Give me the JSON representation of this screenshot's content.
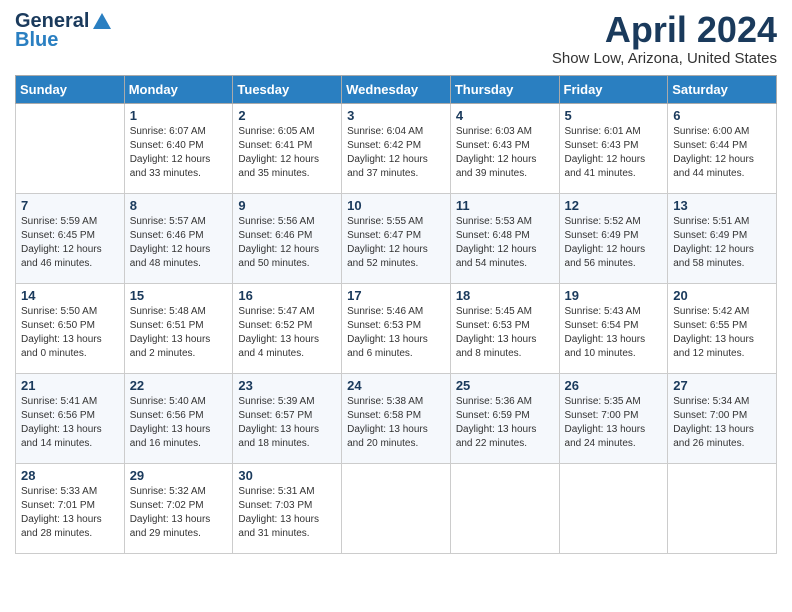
{
  "logo": {
    "general": "General",
    "blue": "Blue",
    "icon": "▶"
  },
  "title": "April 2024",
  "subtitle": "Show Low, Arizona, United States",
  "days_of_week": [
    "Sunday",
    "Monday",
    "Tuesday",
    "Wednesday",
    "Thursday",
    "Friday",
    "Saturday"
  ],
  "weeks": [
    [
      {
        "day": "",
        "content": ""
      },
      {
        "day": "1",
        "content": "Sunrise: 6:07 AM\nSunset: 6:40 PM\nDaylight: 12 hours\nand 33 minutes."
      },
      {
        "day": "2",
        "content": "Sunrise: 6:05 AM\nSunset: 6:41 PM\nDaylight: 12 hours\nand 35 minutes."
      },
      {
        "day": "3",
        "content": "Sunrise: 6:04 AM\nSunset: 6:42 PM\nDaylight: 12 hours\nand 37 minutes."
      },
      {
        "day": "4",
        "content": "Sunrise: 6:03 AM\nSunset: 6:43 PM\nDaylight: 12 hours\nand 39 minutes."
      },
      {
        "day": "5",
        "content": "Sunrise: 6:01 AM\nSunset: 6:43 PM\nDaylight: 12 hours\nand 41 minutes."
      },
      {
        "day": "6",
        "content": "Sunrise: 6:00 AM\nSunset: 6:44 PM\nDaylight: 12 hours\nand 44 minutes."
      }
    ],
    [
      {
        "day": "7",
        "content": "Sunrise: 5:59 AM\nSunset: 6:45 PM\nDaylight: 12 hours\nand 46 minutes."
      },
      {
        "day": "8",
        "content": "Sunrise: 5:57 AM\nSunset: 6:46 PM\nDaylight: 12 hours\nand 48 minutes."
      },
      {
        "day": "9",
        "content": "Sunrise: 5:56 AM\nSunset: 6:46 PM\nDaylight: 12 hours\nand 50 minutes."
      },
      {
        "day": "10",
        "content": "Sunrise: 5:55 AM\nSunset: 6:47 PM\nDaylight: 12 hours\nand 52 minutes."
      },
      {
        "day": "11",
        "content": "Sunrise: 5:53 AM\nSunset: 6:48 PM\nDaylight: 12 hours\nand 54 minutes."
      },
      {
        "day": "12",
        "content": "Sunrise: 5:52 AM\nSunset: 6:49 PM\nDaylight: 12 hours\nand 56 minutes."
      },
      {
        "day": "13",
        "content": "Sunrise: 5:51 AM\nSunset: 6:49 PM\nDaylight: 12 hours\nand 58 minutes."
      }
    ],
    [
      {
        "day": "14",
        "content": "Sunrise: 5:50 AM\nSunset: 6:50 PM\nDaylight: 13 hours\nand 0 minutes."
      },
      {
        "day": "15",
        "content": "Sunrise: 5:48 AM\nSunset: 6:51 PM\nDaylight: 13 hours\nand 2 minutes."
      },
      {
        "day": "16",
        "content": "Sunrise: 5:47 AM\nSunset: 6:52 PM\nDaylight: 13 hours\nand 4 minutes."
      },
      {
        "day": "17",
        "content": "Sunrise: 5:46 AM\nSunset: 6:53 PM\nDaylight: 13 hours\nand 6 minutes."
      },
      {
        "day": "18",
        "content": "Sunrise: 5:45 AM\nSunset: 6:53 PM\nDaylight: 13 hours\nand 8 minutes."
      },
      {
        "day": "19",
        "content": "Sunrise: 5:43 AM\nSunset: 6:54 PM\nDaylight: 13 hours\nand 10 minutes."
      },
      {
        "day": "20",
        "content": "Sunrise: 5:42 AM\nSunset: 6:55 PM\nDaylight: 13 hours\nand 12 minutes."
      }
    ],
    [
      {
        "day": "21",
        "content": "Sunrise: 5:41 AM\nSunset: 6:56 PM\nDaylight: 13 hours\nand 14 minutes."
      },
      {
        "day": "22",
        "content": "Sunrise: 5:40 AM\nSunset: 6:56 PM\nDaylight: 13 hours\nand 16 minutes."
      },
      {
        "day": "23",
        "content": "Sunrise: 5:39 AM\nSunset: 6:57 PM\nDaylight: 13 hours\nand 18 minutes."
      },
      {
        "day": "24",
        "content": "Sunrise: 5:38 AM\nSunset: 6:58 PM\nDaylight: 13 hours\nand 20 minutes."
      },
      {
        "day": "25",
        "content": "Sunrise: 5:36 AM\nSunset: 6:59 PM\nDaylight: 13 hours\nand 22 minutes."
      },
      {
        "day": "26",
        "content": "Sunrise: 5:35 AM\nSunset: 7:00 PM\nDaylight: 13 hours\nand 24 minutes."
      },
      {
        "day": "27",
        "content": "Sunrise: 5:34 AM\nSunset: 7:00 PM\nDaylight: 13 hours\nand 26 minutes."
      }
    ],
    [
      {
        "day": "28",
        "content": "Sunrise: 5:33 AM\nSunset: 7:01 PM\nDaylight: 13 hours\nand 28 minutes."
      },
      {
        "day": "29",
        "content": "Sunrise: 5:32 AM\nSunset: 7:02 PM\nDaylight: 13 hours\nand 29 minutes."
      },
      {
        "day": "30",
        "content": "Sunrise: 5:31 AM\nSunset: 7:03 PM\nDaylight: 13 hours\nand 31 minutes."
      },
      {
        "day": "",
        "content": ""
      },
      {
        "day": "",
        "content": ""
      },
      {
        "day": "",
        "content": ""
      },
      {
        "day": "",
        "content": ""
      }
    ]
  ]
}
